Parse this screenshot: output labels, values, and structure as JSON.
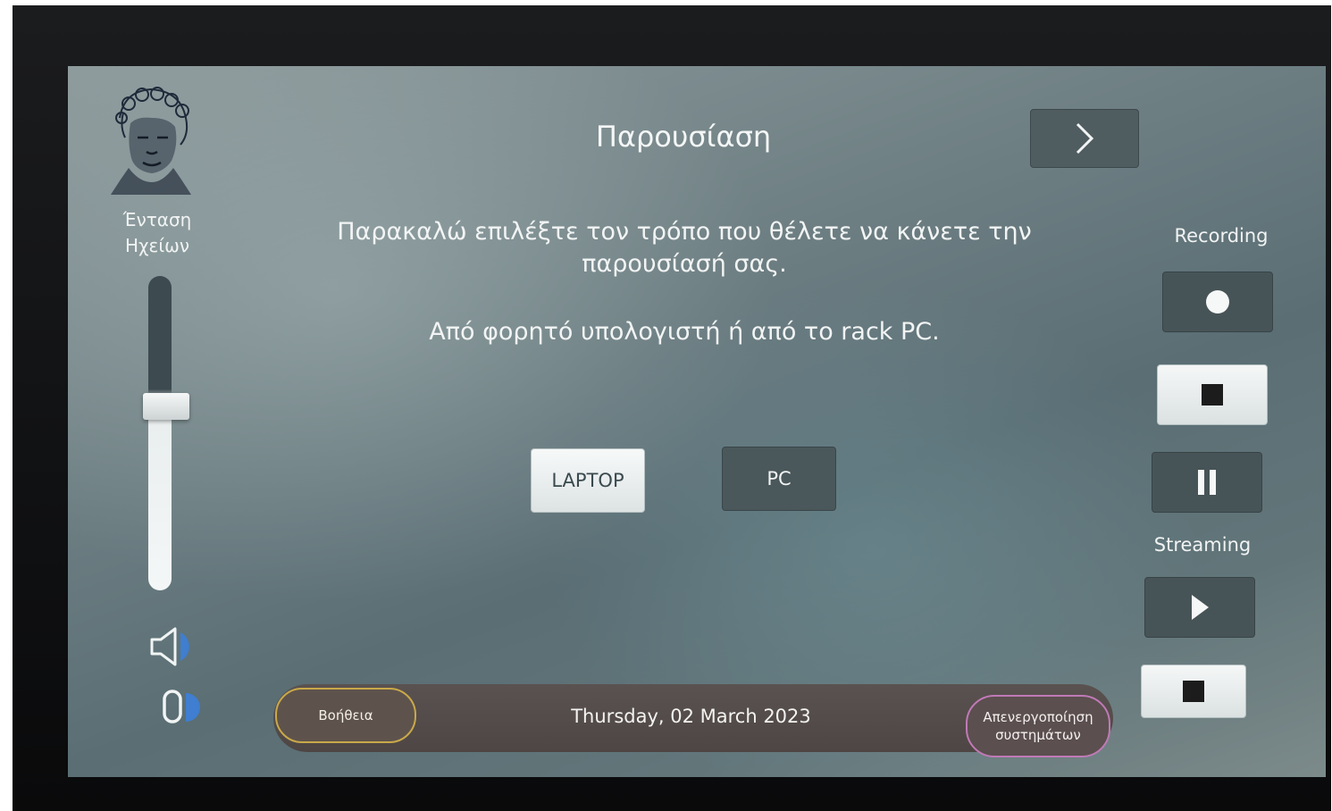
{
  "left_panel": {
    "volume_title_line1": "Ένταση",
    "volume_title_line2": "Ηχείων",
    "volume_level": 0.62,
    "speaker_icon": "speaker-icon",
    "mute_icon": "mute-icon"
  },
  "header": {
    "title": "Παρουσίαση",
    "next_icon": "chevron-right-icon"
  },
  "main": {
    "instruction": "Παρακαλώ επιλέξτε τον τρόπο που θέλετε να κάνετε την παρουσίασή σας.",
    "sub_instruction": "Από φορητό υπολογιστή ή από το rack PC.",
    "laptop_label": "LAPTOP",
    "pc_label": "PC"
  },
  "right_panel": {
    "recording_label": "Recording",
    "streaming_label": "Streaming",
    "record_icon": "record-icon",
    "stop_icon": "stop-icon",
    "pause_icon": "pause-icon",
    "play_icon": "play-icon"
  },
  "footer": {
    "help_label": "Βοήθεια",
    "date": "Thursday, 02 March 2023",
    "shutdown_line1": "Απενεργοποίηση",
    "shutdown_line2": "συστημάτων"
  },
  "colors": {
    "help_border": "#c9a94a",
    "shutdown_border": "#c07ab7"
  }
}
